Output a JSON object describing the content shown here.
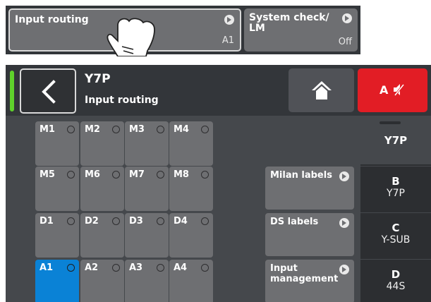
{
  "preview": {
    "tile_main": {
      "label": "Input routing",
      "value": "A1"
    },
    "tile_side": {
      "label": "System check/ LM",
      "value": "Off"
    }
  },
  "header": {
    "title": "Y7P",
    "subtitle": "Input routing",
    "mute_label": "A",
    "status_color": "#5fd12b",
    "mute_color": "#e21d25"
  },
  "inputs": [
    {
      "label": "M1"
    },
    {
      "label": "M2"
    },
    {
      "label": "M3"
    },
    {
      "label": "M4"
    },
    {
      "label": "M5"
    },
    {
      "label": "M6"
    },
    {
      "label": "M7"
    },
    {
      "label": "M8"
    },
    {
      "label": "D1"
    },
    {
      "label": "D2"
    },
    {
      "label": "D3"
    },
    {
      "label": "D4"
    },
    {
      "label": "A1",
      "selected": true
    },
    {
      "label": "A2"
    },
    {
      "label": "A3"
    },
    {
      "label": "A4"
    }
  ],
  "side_buttons": {
    "milan": "Milan labels",
    "ds": "DS labels",
    "input_mgmt": "Input management"
  },
  "tabs": {
    "current": "Y7P",
    "b": {
      "letter": "B",
      "name": "Y7P"
    },
    "c": {
      "letter": "C",
      "name": "Y-SUB"
    },
    "d": {
      "letter": "D",
      "name": "44S"
    }
  },
  "accent_color": "#0a82d6"
}
